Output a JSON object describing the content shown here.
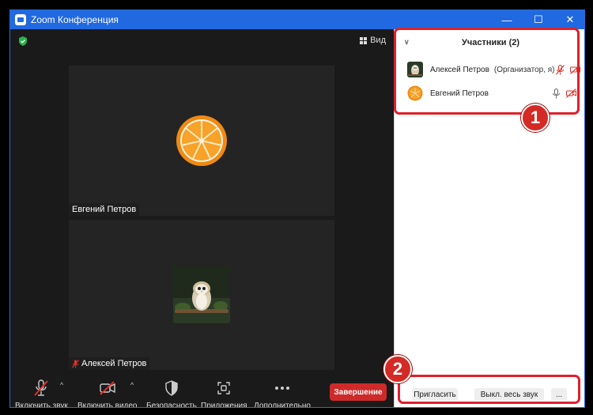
{
  "window": {
    "title": "Zoom Конференция",
    "controls": {
      "minimize": "—",
      "maximize": "☐",
      "close": "✕"
    }
  },
  "video": {
    "view_label": "Вид",
    "tiles": [
      {
        "name": "Евгений Петров",
        "avatar": "orange-slice"
      },
      {
        "name": "Алексей Петров",
        "avatar": "owl-photo",
        "muted": true
      }
    ]
  },
  "toolbar": {
    "unmute_label": "Включить звук",
    "video_label": "Включить видео",
    "security_label": "Безопасность",
    "apps_label": "Приложения",
    "more_label": "Дополнительно",
    "end_label": "Завершение"
  },
  "panel": {
    "title": "Участники (2)",
    "participants": [
      {
        "name": "Алексей Петров",
        "role": "(Организатор, я)",
        "mic": "muted",
        "video": "off"
      },
      {
        "name": "Евгений Петров",
        "role": "",
        "mic": "on",
        "video": "off"
      }
    ],
    "footer": {
      "invite_label": "Пригласить",
      "mute_all_label": "Выкл. весь звук",
      "more_label": "..."
    }
  },
  "annotations": {
    "badge1": "1",
    "badge2": "2"
  },
  "colors": {
    "titlebar": "#2169e0",
    "end_button": "#cf2a2a",
    "annotation": "#e0202a",
    "shield": "#27b24a"
  }
}
